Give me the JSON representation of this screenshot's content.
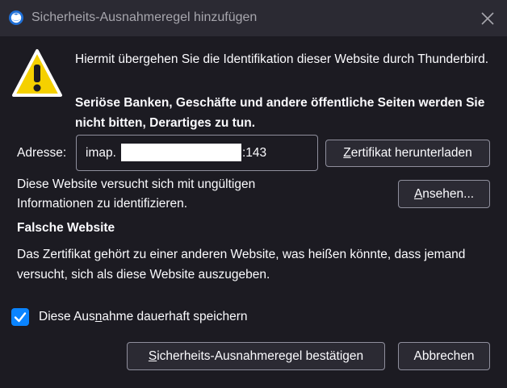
{
  "window": {
    "title": "Sicherheits-Ausnahmeregel hinzufügen",
    "app_icon": "thunderbird-logo",
    "close_icon": "close-icon"
  },
  "warning": {
    "icon": "warning-triangle-icon",
    "message": "Hiermit übergehen Sie die Identifikation dieser Website durch Thunderbird.",
    "bold_message": "Seriöse Banken, Geschäfte und andere öffentliche Seiten werden Sie nicht bitten, Derartiges zu tun."
  },
  "address": {
    "label": "Adresse:",
    "prefix": "imap.",
    "suffix": ":143"
  },
  "buttons": {
    "download": {
      "pre": "",
      "key": "Z",
      "post": "ertifikat herunterladen"
    },
    "view": {
      "pre": "",
      "key": "A",
      "post": "nsehen..."
    },
    "confirm": {
      "pre": "",
      "key": "S",
      "post": "icherheits-Ausnahmeregel bestätigen"
    },
    "cancel": "Abbrechen"
  },
  "status": {
    "info": "Diese Website versucht sich mit ungültigen Informationen zu identifizieren.",
    "heading": "Falsche Website",
    "description": "Das Zertifikat gehört zu einer anderen Website, was heißen könnte, dass jemand versucht, sich als diese Website auszugeben."
  },
  "permanent": {
    "checked": true,
    "label_pre": "Diese Aus",
    "label_key": "n",
    "label_post": "ahme dauerhaft speichern"
  },
  "colors": {
    "background": "#1c1b22",
    "titlebar": "#2b2a33",
    "accent": "#0a84ff",
    "warning_yellow": "#f5d000"
  }
}
